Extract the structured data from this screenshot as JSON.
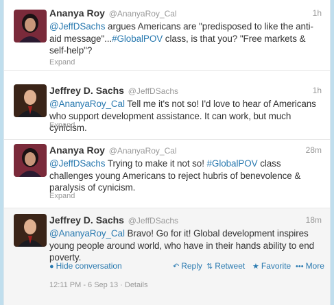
{
  "colors": {
    "background": "#c0deed",
    "link": "#2a7ab0",
    "muted": "#999999",
    "text": "#333333"
  },
  "tweets": [
    {
      "fullname": "Ananya Roy",
      "username": "@AnanyaRoy_Cal",
      "time": "1h",
      "segments": [
        {
          "t": "@JeffDSachs",
          "link": true
        },
        {
          "t": " argues Americans are \"predisposed to like the anti-aid message\"...",
          "link": false
        },
        {
          "t": "#GlobalPOV",
          "link": true
        },
        {
          "t": " class, is that you? \"Free markets & self-help\"?",
          "link": false
        }
      ],
      "expand": "Expand"
    },
    {
      "fullname": "Jeffrey D. Sachs",
      "username": "@JeffDSachs",
      "time": "1h",
      "segments": [
        {
          "t": "@AnanyaRoy_Cal",
          "link": true
        },
        {
          "t": " Tell me it's not so!  I'd love to hear of Americans who support development assistance. It can work, but much cynicism.",
          "link": false
        }
      ],
      "expand": "Expand"
    },
    {
      "fullname": "Ananya Roy",
      "username": "@AnanyaRoy_Cal",
      "time": "28m",
      "segments": [
        {
          "t": "@JeffDSachs",
          "link": true
        },
        {
          "t": " Trying to make it not so! ",
          "link": false
        },
        {
          "t": "#GlobalPOV",
          "link": true
        },
        {
          "t": " class challenges young Americans to reject hubris of benevolence & paralysis of cynicism.",
          "link": false
        }
      ],
      "expand": "Expand"
    },
    {
      "fullname": "Jeffrey D. Sachs",
      "username": "@JeffDSachs",
      "time": "18m",
      "segments": [
        {
          "t": "@AnanyaRoy_Cal",
          "link": true
        },
        {
          "t": " Bravo!  Go for it! Global development inspires young people around world, who have in their hands ability to end poverty.",
          "link": false
        }
      ]
    }
  ],
  "actions": {
    "hide": "Hide conversation",
    "reply": "Reply",
    "retweet": "Retweet",
    "favorite": "Favorite",
    "more": "More"
  },
  "icons": {
    "hide": "minus-circle-icon",
    "reply": "reply-arrow-icon",
    "retweet": "retweet-icon",
    "favorite": "star-icon",
    "more": "dots-icon"
  },
  "meta": {
    "timestamp": "12:11 PM - 6 Sep 13",
    "separator": " · ",
    "details": "Details"
  }
}
